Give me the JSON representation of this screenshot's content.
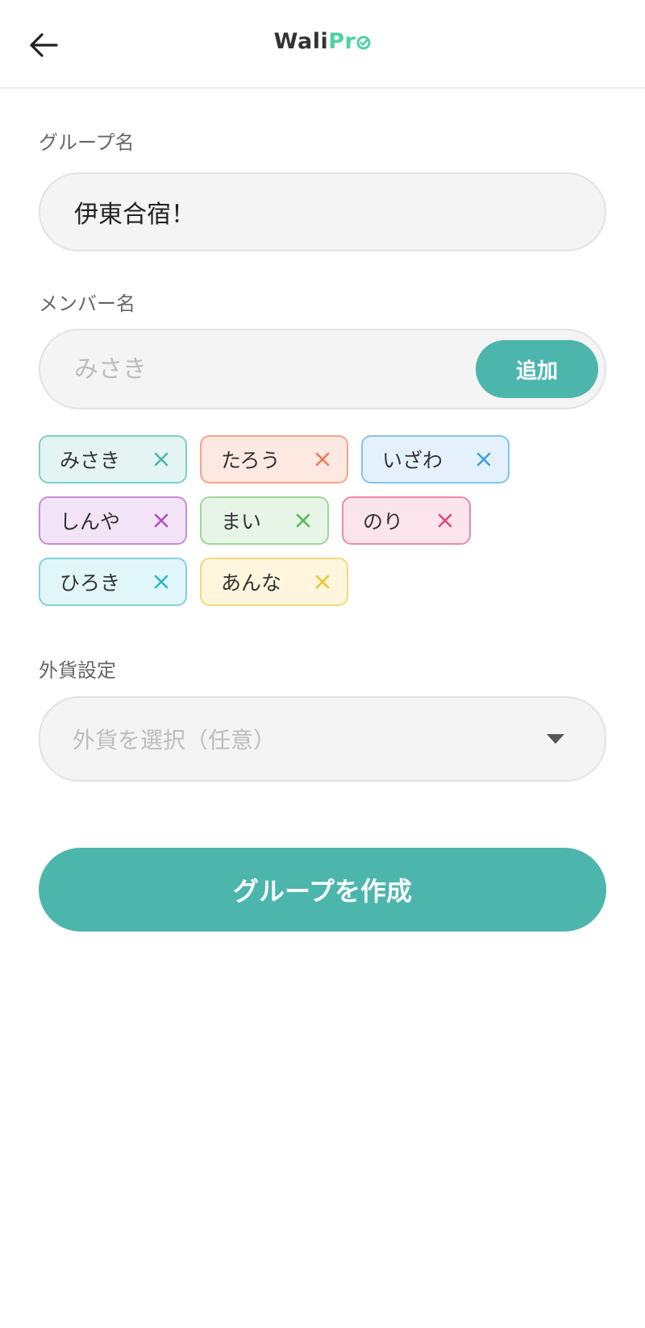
{
  "header": {
    "back_icon": "arrow-left-icon",
    "logo_wali": "Wali",
    "logo_pro": "Pr",
    "logo_check_icon": "check-circle-icon"
  },
  "group_name": {
    "label": "グループ名",
    "value": "伊東合宿！"
  },
  "member_name": {
    "label": "メンバー名",
    "placeholder": "みさき",
    "add_label": "追加"
  },
  "members": [
    {
      "name": "みさき",
      "bg": "#e3f4f2",
      "border": "#7fcfc4",
      "x": "#4db6ac",
      "width": 184
    },
    {
      "name": "たろう",
      "bg": "#fde8e2",
      "border": "#f5a58c",
      "x": "#f07a55",
      "width": 184
    },
    {
      "name": "いざわ",
      "bg": "#e4f1fc",
      "border": "#85c2ec",
      "x": "#3f9fe0",
      "width": 184
    },
    {
      "name": "しんや",
      "bg": "#f3e3f6",
      "border": "#c98bd4",
      "x": "#b04fc2",
      "width": 184
    },
    {
      "name": "まい",
      "bg": "#e7f5e6",
      "border": "#9fd69b",
      "x": "#5cb85c",
      "width": 160
    },
    {
      "name": "のり",
      "bg": "#fce4ec",
      "border": "#ec8aaa",
      "x": "#e0457a",
      "width": 160
    },
    {
      "name": "ひろき",
      "bg": "#e1f6f8",
      "border": "#7fd4de",
      "x": "#26b9cc",
      "width": 184
    },
    {
      "name": "あんな",
      "bg": "#fff6dd",
      "border": "#f5d77a",
      "x": "#f4c22b",
      "width": 184
    }
  ],
  "currency": {
    "label": "外貨設定",
    "placeholder": "外貨を選択（任意）"
  },
  "create_label": "グループを作成",
  "colors": {
    "accent": "#4db6ac",
    "logo_pro": "#4ed3a3"
  }
}
